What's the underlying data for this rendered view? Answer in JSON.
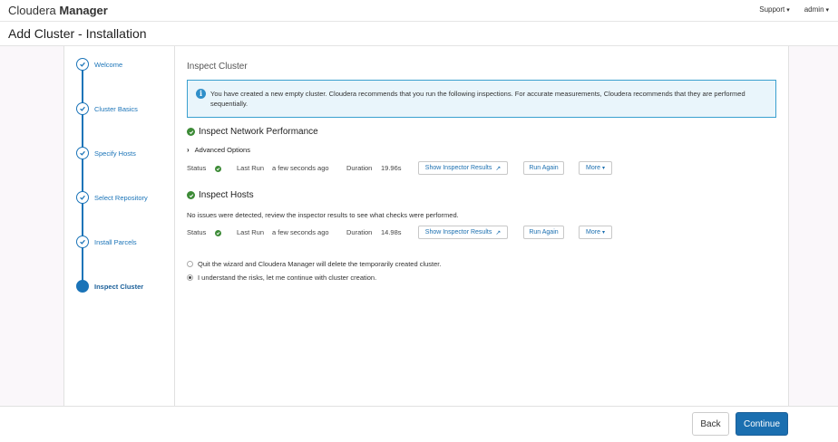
{
  "brand": {
    "part1": "Cloudera",
    "part2": "Manager"
  },
  "topnav": {
    "support": "Support",
    "user": "admin"
  },
  "page": {
    "title": "Add Cluster - Installation"
  },
  "steps": [
    {
      "label": "Welcome",
      "state": "done"
    },
    {
      "label": "Cluster Basics",
      "state": "done"
    },
    {
      "label": "Specify Hosts",
      "state": "done"
    },
    {
      "label": "Select Repository",
      "state": "done"
    },
    {
      "label": "Install Parcels",
      "state": "done"
    },
    {
      "label": "Inspect Cluster",
      "state": "active"
    }
  ],
  "main": {
    "title": "Inspect Cluster",
    "info": "You have created a new empty cluster. Cloudera recommends that you run the following inspections. For accurate measurements, Cloudera recommends that they are performed sequentially.",
    "network": {
      "title": "Inspect Network Performance",
      "advanced": "Advanced Options",
      "status_label": "Status",
      "last_run_label": "Last Run",
      "last_run": "a few seconds ago",
      "duration_label": "Duration",
      "duration": "19.96s",
      "show_results": "Show Inspector Results",
      "run_again": "Run Again",
      "more": "More"
    },
    "hosts": {
      "title": "Inspect Hosts",
      "message": "No issues were detected, review the inspector results to see what checks were performed.",
      "status_label": "Status",
      "last_run_label": "Last Run",
      "last_run": "a few seconds ago",
      "duration_label": "Duration",
      "duration": "14.98s",
      "show_results": "Show Inspector Results",
      "run_again": "Run Again",
      "more": "More"
    },
    "options": {
      "quit": "Quit the wizard and Cloudera Manager will delete the temporarily created cluster.",
      "continue": "I understand the risks, let me continue with cluster creation.",
      "selected": "continue"
    }
  },
  "footer": {
    "back": "Back",
    "continue": "Continue"
  },
  "colors": {
    "accent": "#1b6fb0",
    "success": "#3d8b37",
    "info_border": "#3aa0cf"
  }
}
